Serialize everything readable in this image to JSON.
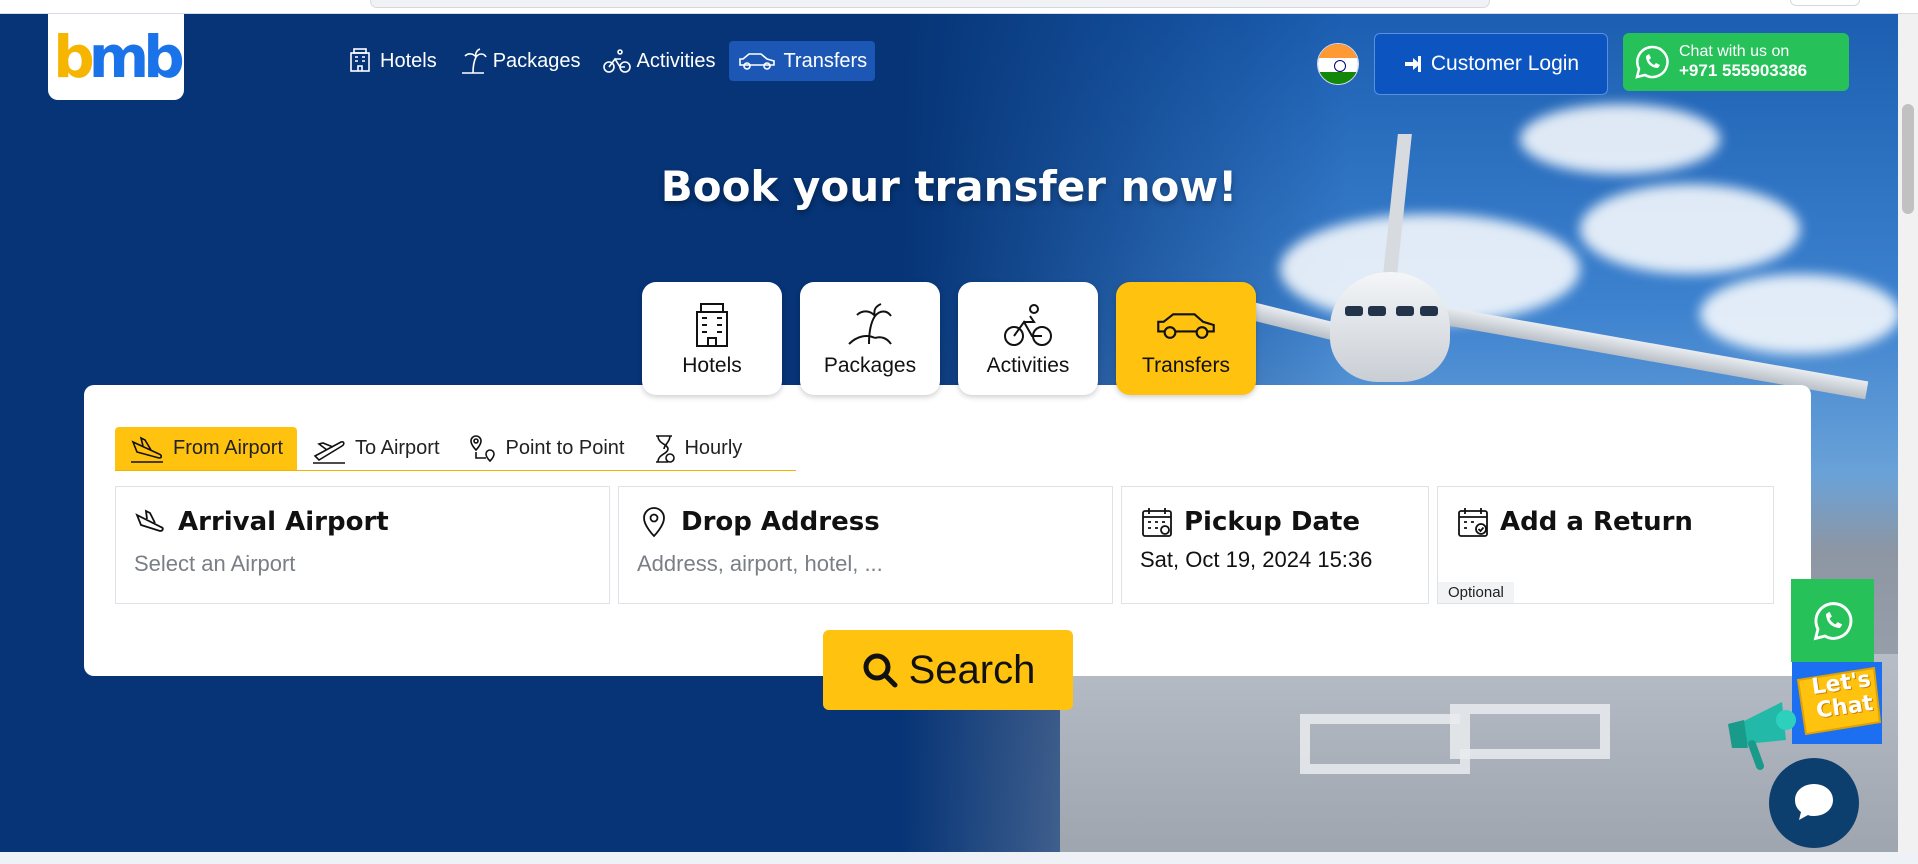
{
  "header": {
    "logo_text": {
      "b1": "b",
      "m": "m",
      "b2": "b"
    },
    "nav": [
      {
        "label": "Hotels",
        "icon": "hotel-icon",
        "active": false
      },
      {
        "label": "Packages",
        "icon": "palm-tree-icon",
        "active": false
      },
      {
        "label": "Activities",
        "icon": "cyclist-icon",
        "active": false
      },
      {
        "label": "Transfers",
        "icon": "car-icon",
        "active": true
      }
    ],
    "flag_icon": "india-flag-icon",
    "login_label": "Customer Login",
    "chat_line1": "Chat with us on",
    "chat_line2": "+971 555903386"
  },
  "hero": {
    "headline": "Book your transfer now!"
  },
  "categories": [
    {
      "label": "Hotels",
      "icon": "hotel-icon",
      "active": false
    },
    {
      "label": "Packages",
      "icon": "palm-tree-icon",
      "active": false
    },
    {
      "label": "Activities",
      "icon": "cyclist-icon",
      "active": false
    },
    {
      "label": "Transfers",
      "icon": "car-icon",
      "active": true
    }
  ],
  "subtabs": [
    {
      "label": "From Airport",
      "icon": "plane-landing-icon",
      "active": true
    },
    {
      "label": "To Airport",
      "icon": "plane-takeoff-icon",
      "active": false
    },
    {
      "label": "Point to Point",
      "icon": "route-pin-icon",
      "active": false
    },
    {
      "label": "Hourly",
      "icon": "hourglass-icon",
      "active": false
    }
  ],
  "fields": {
    "arrival": {
      "label": "Arrival Airport",
      "placeholder": "Select an Airport"
    },
    "drop": {
      "label": "Drop Address",
      "placeholder": "Address, airport, hotel, ..."
    },
    "pickup": {
      "label": "Pickup Date",
      "value": "Sat, Oct 19, 2024 15:36"
    },
    "return": {
      "label": "Add a Return",
      "badge": "Optional"
    }
  },
  "search_label": "Search",
  "widgets": {
    "lets_chat": "Let's Chat"
  },
  "colors": {
    "primary": "#063476",
    "accent": "#ffc20e",
    "whatsapp": "#27c15a",
    "login": "#0c55c0"
  }
}
